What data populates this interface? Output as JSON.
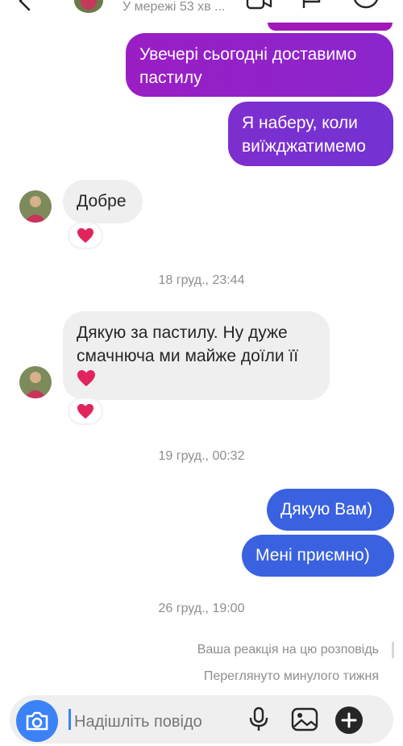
{
  "header": {
    "status": "У мережі 53 хв ..."
  },
  "messages": [
    {
      "side": "out",
      "text": "Увечері сьогодні доставимо пастилу"
    },
    {
      "side": "out",
      "text": "Я наберу, коли виїжджатимемо"
    },
    {
      "side": "in",
      "text": "Добре",
      "reaction": "heart"
    },
    {
      "side": "in",
      "text": "Дякую за пастилу. Ну дуже смачнюча ми майже доїли її",
      "reaction": "heart"
    },
    {
      "side": "out",
      "text": "Дякую Вам)"
    },
    {
      "side": "out",
      "text": "Мені приємно)"
    }
  ],
  "timestamps": [
    "18 груд., 23:44",
    "19 груд., 00:32",
    "26 груд., 19:00"
  ],
  "meta": {
    "reaction_note": "Ваша реакція на цю розповідь",
    "seen": "Переглянуто минулого тижня"
  },
  "composer": {
    "placeholder": "Надішліть повідо"
  },
  "icons": {
    "back": "chevron-left-icon",
    "video": "video-call-icon",
    "flag": "flag-icon",
    "info": "info-icon",
    "camera": "camera-icon",
    "mic": "microphone-icon",
    "gallery": "gallery-icon",
    "plus": "plus-icon",
    "reaction": "heart-icon"
  },
  "colors": {
    "outgoing_purple": "#9a1ec4",
    "outgoing_blue": "#3a62e0",
    "incoming_gray": "#efefef",
    "camera_button": "#3b82f6",
    "heart": "#e0245e"
  }
}
